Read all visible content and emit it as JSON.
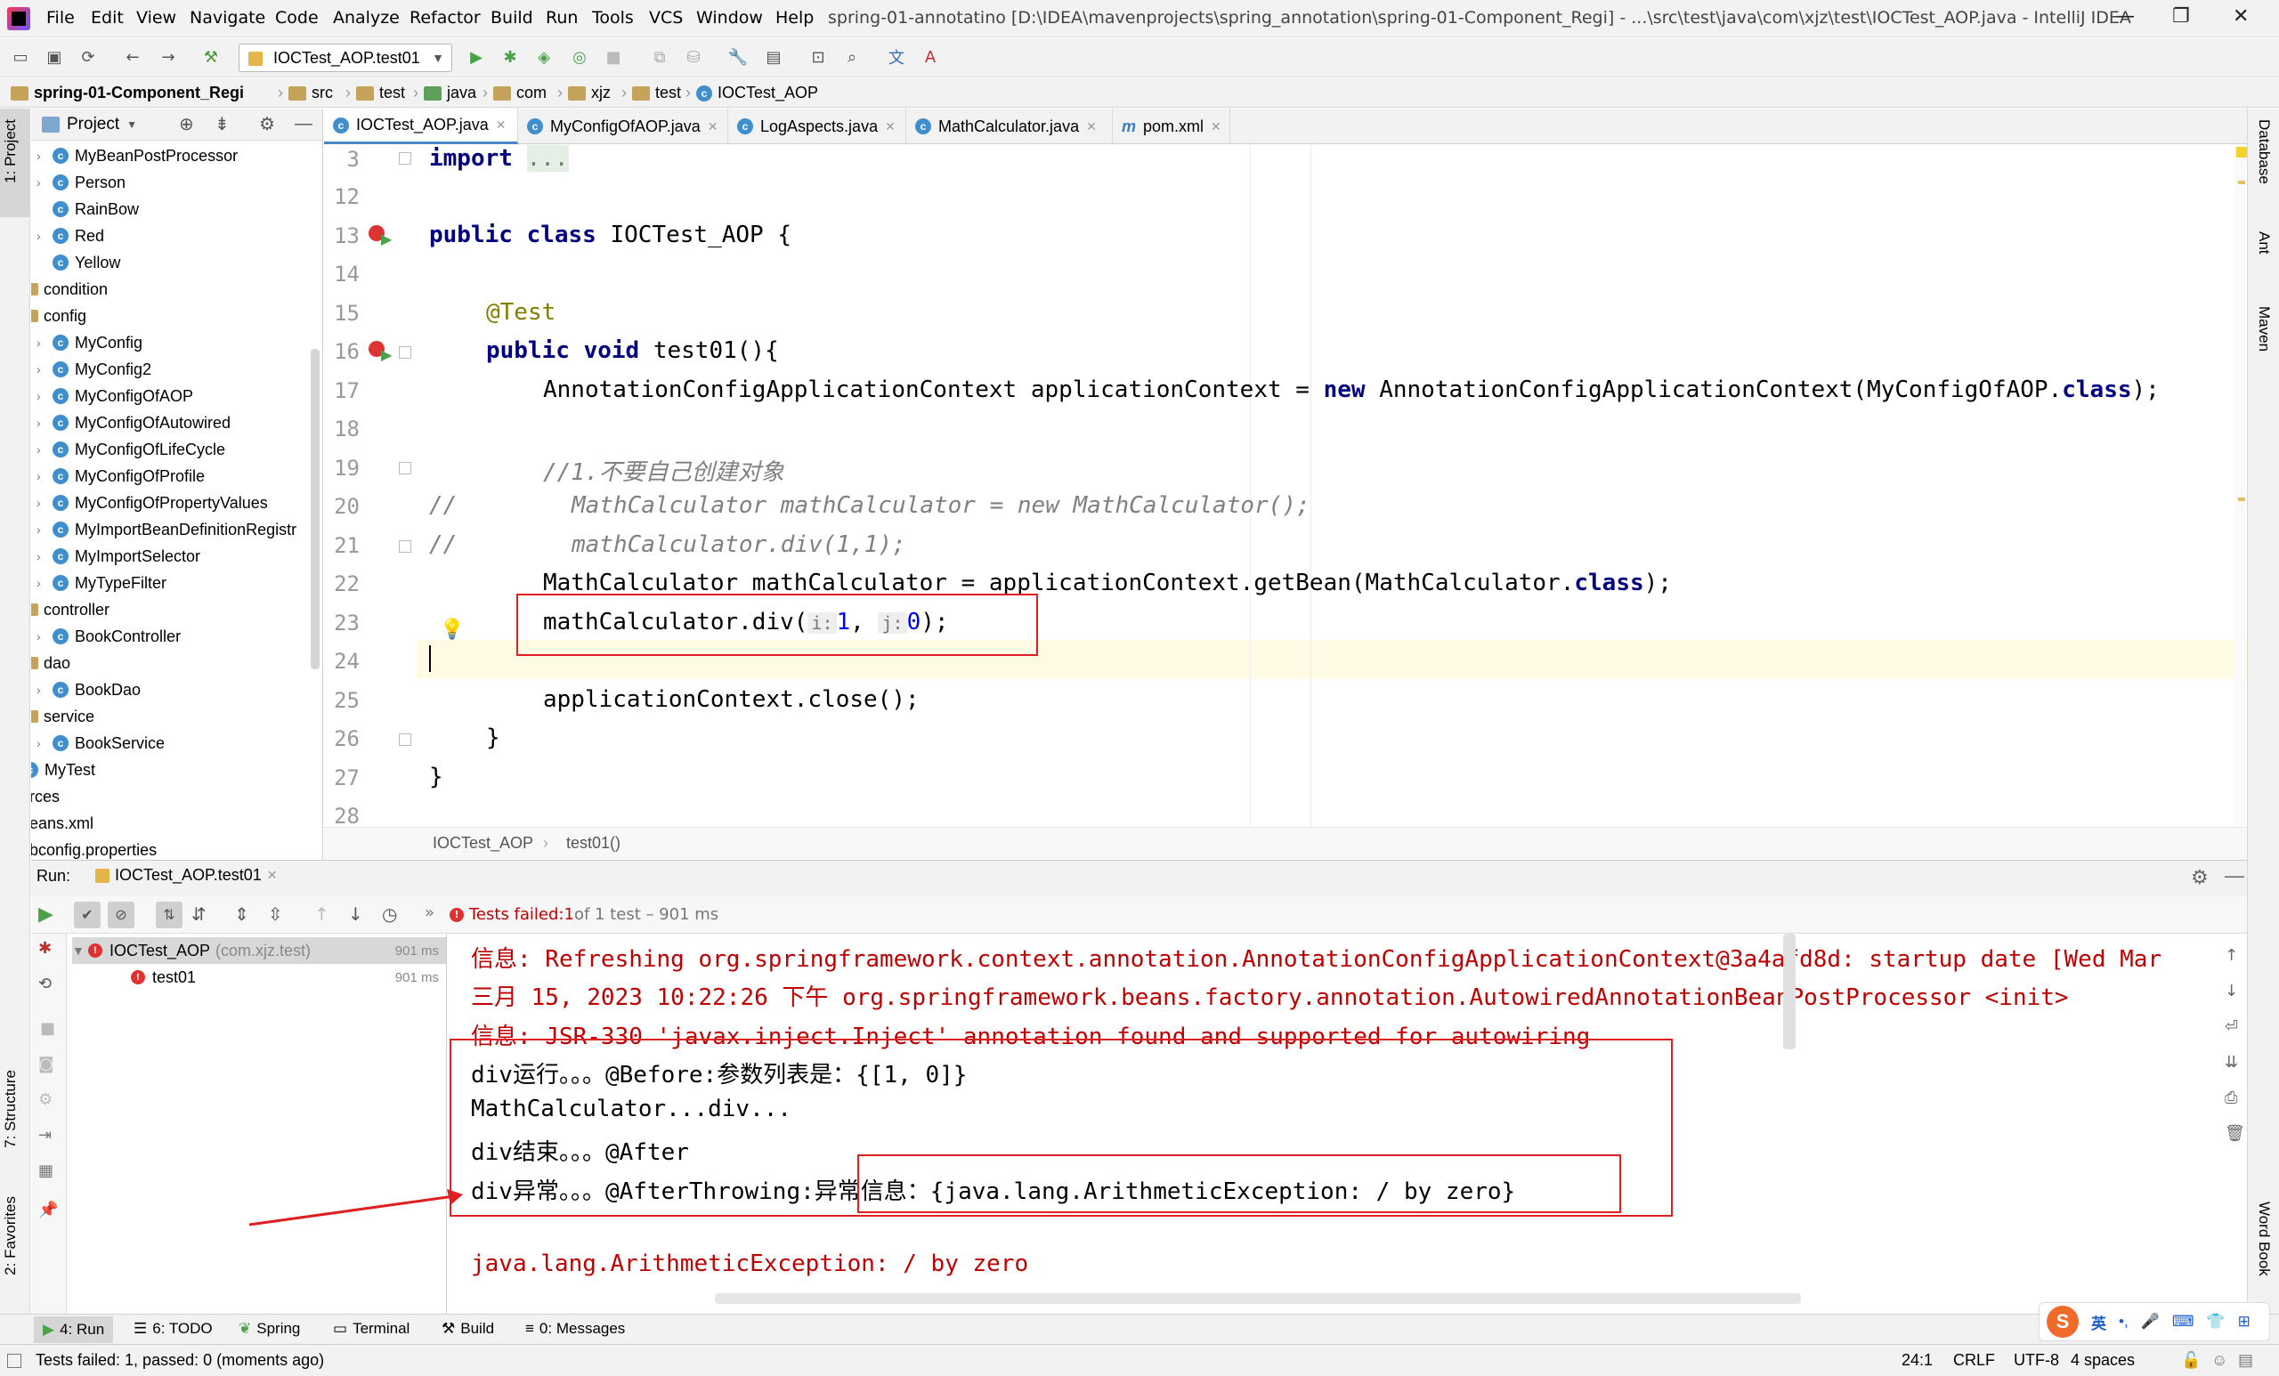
{
  "menubar": {
    "items": [
      "File",
      "Edit",
      "View",
      "Navigate",
      "Code",
      "Analyze",
      "Refactor",
      "Build",
      "Run",
      "Tools",
      "VCS",
      "Window",
      "Help"
    ],
    "window_title": "spring-01-annotatino [D:\\IDEA\\mavenprojects\\spring_annotation\\spring-01-Component_Regi] - ...\\src\\test\\java\\com\\xjz\\test\\IOCTest_AOP.java - IntelliJ IDEA"
  },
  "toolbar": {
    "run_config": "IOCTest_AOP.test01"
  },
  "breadcrumbs": [
    "spring-01-Component_Regi",
    "src",
    "test",
    "java",
    "com",
    "xjz",
    "test",
    "IOCTest_AOP"
  ],
  "tool_windows": {
    "left": [
      "1: Project",
      "7: Structure",
      "2: Favorites"
    ],
    "right": [
      "Database",
      "Ant",
      "Maven",
      "Word Book"
    ]
  },
  "project": {
    "header": "Project",
    "items": [
      {
        "label": "MyBeanPostProcessor",
        "type": "class",
        "arrow": true
      },
      {
        "label": "Person",
        "type": "class",
        "arrow": true
      },
      {
        "label": "RainBow",
        "type": "class",
        "arrow": false
      },
      {
        "label": "Red",
        "type": "class",
        "arrow": true
      },
      {
        "label": "Yellow",
        "type": "class",
        "arrow": false
      },
      {
        "label": "condition",
        "type": "folder",
        "arrow": true
      },
      {
        "label": "config",
        "type": "folder",
        "arrow": false
      },
      {
        "label": "MyConfig",
        "type": "class",
        "arrow": true
      },
      {
        "label": "MyConfig2",
        "type": "class",
        "arrow": true
      },
      {
        "label": "MyConfigOfAOP",
        "type": "class",
        "arrow": true
      },
      {
        "label": "MyConfigOfAutowired",
        "type": "class",
        "arrow": true
      },
      {
        "label": "MyConfigOfLifeCycle",
        "type": "class",
        "arrow": true
      },
      {
        "label": "MyConfigOfProfile",
        "type": "class",
        "arrow": true
      },
      {
        "label": "MyConfigOfPropertyValues",
        "type": "class",
        "arrow": true
      },
      {
        "label": "MyImportBeanDefinitionRegistr",
        "type": "class",
        "arrow": true
      },
      {
        "label": "MyImportSelector",
        "type": "class",
        "arrow": true
      },
      {
        "label": "MyTypeFilter",
        "type": "class",
        "arrow": true
      },
      {
        "label": "controller",
        "type": "folder",
        "arrow": false
      },
      {
        "label": "BookController",
        "type": "class",
        "arrow": true
      },
      {
        "label": "dao",
        "type": "folder",
        "arrow": false
      },
      {
        "label": "BookDao",
        "type": "class",
        "arrow": true
      },
      {
        "label": "service",
        "type": "folder",
        "arrow": false
      },
      {
        "label": "BookService",
        "type": "class",
        "arrow": true
      },
      {
        "label": "MyTest",
        "type": "class",
        "arrow": false
      },
      {
        "label": "urces",
        "type": "plain",
        "arrow": false
      },
      {
        "label": "beans.xml",
        "type": "plain",
        "arrow": false
      },
      {
        "label": "dbconfig.properties",
        "type": "plain",
        "arrow": false
      }
    ]
  },
  "tabs": [
    {
      "label": "IOCTest_AOP.java",
      "active": true
    },
    {
      "label": "MyConfigOfAOP.java",
      "active": false
    },
    {
      "label": "LogAspects.java",
      "active": false
    },
    {
      "label": "MathCalculator.java",
      "active": false
    },
    {
      "label": "pom.xml",
      "active": false
    }
  ],
  "editor": {
    "line_numbers": [
      "3",
      "12",
      "13",
      "14",
      "15",
      "16",
      "17",
      "18",
      "19",
      "20",
      "21",
      "22",
      "23",
      "24",
      "25",
      "26",
      "27",
      "28"
    ],
    "import_kw": "import",
    "import_fold": "...",
    "class_kw": "public class",
    "class_name": "IOCTest_AOP {",
    "test_annotation": "@Test",
    "method_kw": "public void",
    "method_sig": "test01(){",
    "line17_a": "AnnotationConfigApplicationContext applicationContext = ",
    "line17_new": "new",
    "line17_b": " AnnotationConfigApplicationContext(MyConfigOfAOP.",
    "line17_class": "class",
    "line17_c": ");",
    "comment1": "//1.不要自己创建对象",
    "comment2_prefix": "//",
    "comment2": "MathCalculator mathCalculator = new MathCalculator();",
    "comment3_prefix": "//",
    "comment3": "mathCalculator.div(1,1);",
    "line22_a": "MathCalculator mathCalculator = applicationContext.getBean(MathCalculator.",
    "line22_class": "class",
    "line22_b": ");",
    "line23_a": "mathCalculator.div(",
    "hint_i": "i:",
    "arg1": "1",
    "comma": ", ",
    "hint_j": "j:",
    "arg2": "0",
    "line23_b": ");",
    "line25": "applicationContext.close();",
    "brace_method": "}",
    "brace_class": "}",
    "breadcrumb": [
      "IOCTest_AOP",
      "test01()"
    ]
  },
  "run": {
    "label": "Run:",
    "tab": "IOCTest_AOP.test01",
    "status_prefix": "Tests failed: ",
    "status_failed": "1",
    "status_suffix": " of 1 test – 901 ms",
    "tree": [
      {
        "label": "IOCTest_AOP",
        "pkg": "(com.xjz.test)",
        "time": "901 ms"
      },
      {
        "label": "test01",
        "pkg": "",
        "time": "901 ms"
      }
    ],
    "console": [
      {
        "text": "信息: Refreshing org.springframework.context.annotation.AnnotationConfigApplicationContext@3a4afd8d: startup date [Wed Mar",
        "color": "red"
      },
      {
        "text": "三月 15, 2023 10:22:26 下午 org.springframework.beans.factory.annotation.AutowiredAnnotationBeanPostProcessor <init>",
        "color": "red"
      },
      {
        "text": "信息: JSR-330 'javax.inject.Inject' annotation found and supported for autowiring",
        "color": "red"
      },
      {
        "text": "div运行。。。@Before:参数列表是：{[1, 0]}",
        "color": "black"
      },
      {
        "text": "MathCalculator...div...",
        "color": "black"
      },
      {
        "text": "div结束。。。@After",
        "color": "black"
      },
      {
        "text": "div异常。。。@AfterThrowing:异常信息：{java.lang.ArithmeticException: / by zero}",
        "color": "black"
      },
      {
        "text": "",
        "color": "black"
      },
      {
        "text": "java.lang.ArithmeticException: / by zero",
        "color": "red"
      }
    ]
  },
  "bottom_tools": [
    "4: Run",
    "6: TODO",
    "Spring",
    "Terminal",
    "Build",
    "0: Messages"
  ],
  "statusbar": {
    "message": "Tests failed: 1, passed: 0 (moments ago)",
    "position": "24:1",
    "line_sep": "CRLF",
    "encoding": "UTF-8",
    "indent": "4 spaces"
  },
  "colors": {
    "keyword": "#000080",
    "annotation": "#808000",
    "comment": "#808080",
    "number": "#0000ff",
    "error_red": "#c00000",
    "highlight_box": "#e02020"
  }
}
